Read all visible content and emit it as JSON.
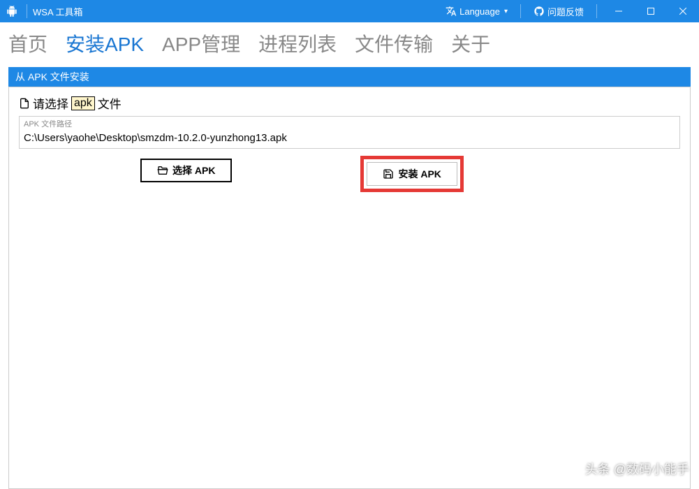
{
  "titlebar": {
    "app_title": "WSA 工具箱",
    "language_label": "Language",
    "feedback_label": "问题反馈"
  },
  "nav": {
    "items": [
      {
        "label": "首页",
        "active": false
      },
      {
        "label": "安装APK",
        "active": true
      },
      {
        "label": "APP管理",
        "active": false
      },
      {
        "label": "进程列表",
        "active": false
      },
      {
        "label": "文件传输",
        "active": false
      },
      {
        "label": "关于",
        "active": false
      }
    ]
  },
  "section": {
    "header": "从 APK 文件安装",
    "select_prefix": "请选择",
    "select_boxed": "apk",
    "select_suffix": "文件",
    "path_caption": "APK 文件路径",
    "path_value": "C:\\Users\\yaohe\\Desktop\\smzdm-10.2.0-yunzhong13.apk",
    "choose_btn": "选择 APK",
    "install_btn": "安装 APK"
  },
  "watermark": "头条 @数码小能手"
}
